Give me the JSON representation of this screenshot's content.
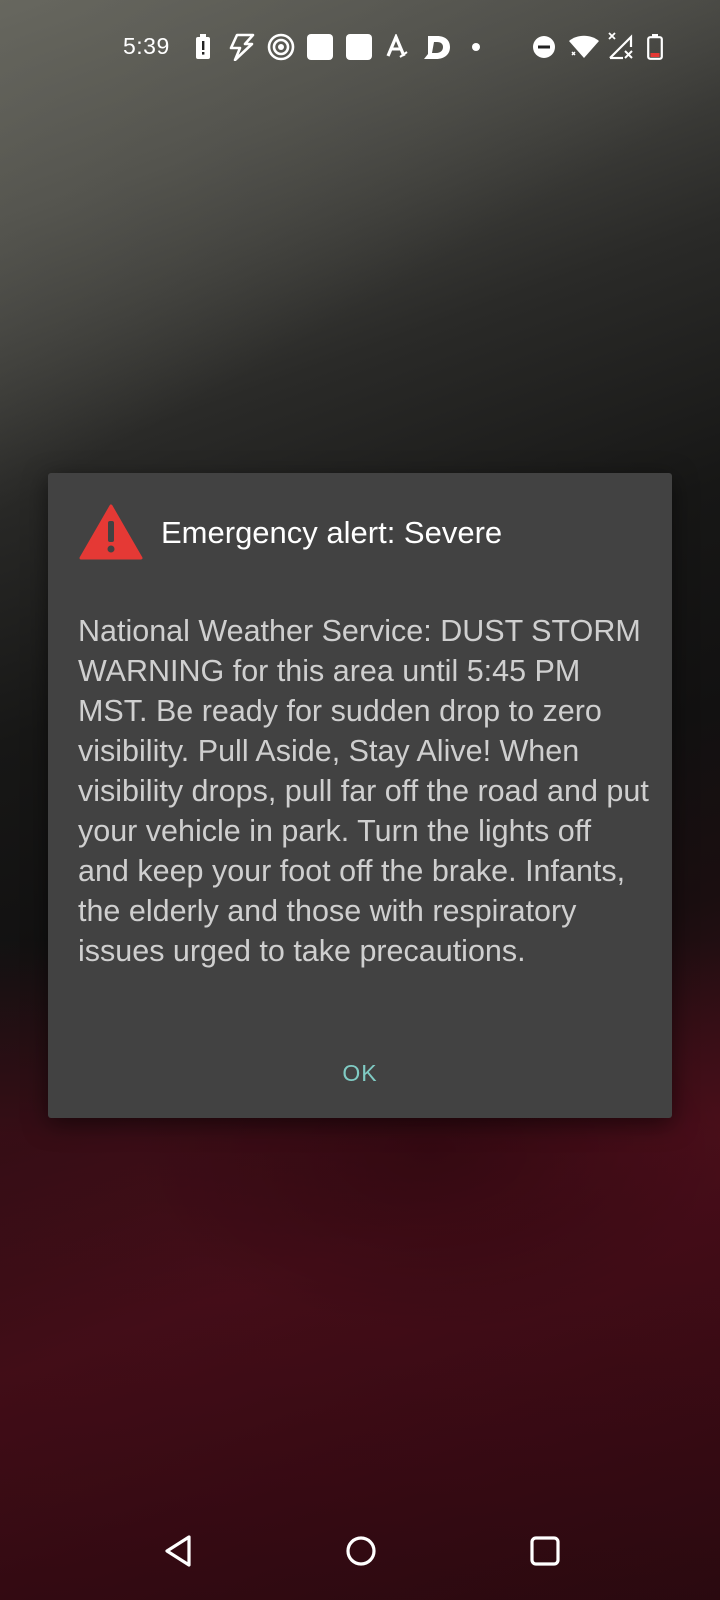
{
  "status_bar": {
    "time": "5:39",
    "icons": [
      "battery-alert-icon",
      "lightning-icon",
      "target-icon",
      "app-square-icon",
      "app-square-icon",
      "font-a-icon",
      "d-app-icon",
      "dot-icon",
      "do-not-disturb-icon",
      "wifi-icon",
      "signal-off-icon",
      "battery-low-icon"
    ]
  },
  "dialog": {
    "icon": "warning-triangle-icon",
    "icon_color": "#e53935",
    "title": "Emergency alert: Severe",
    "message": "National Weather Service: DUST STORM WARNING for this area until 5:45 PM MST. Be ready for sudden drop to zero visibility. Pull Aside, Stay Alive! When visibility drops, pull far off the road and put your vehicle in park. Turn the lights off and keep your foot off the brake. Infants, the elderly and those with respiratory issues urged to take precautions.",
    "ok_label": "OK",
    "accent_color": "#80cbc4"
  },
  "nav_bar": {
    "buttons": [
      "back-icon",
      "home-icon",
      "recents-icon"
    ]
  }
}
